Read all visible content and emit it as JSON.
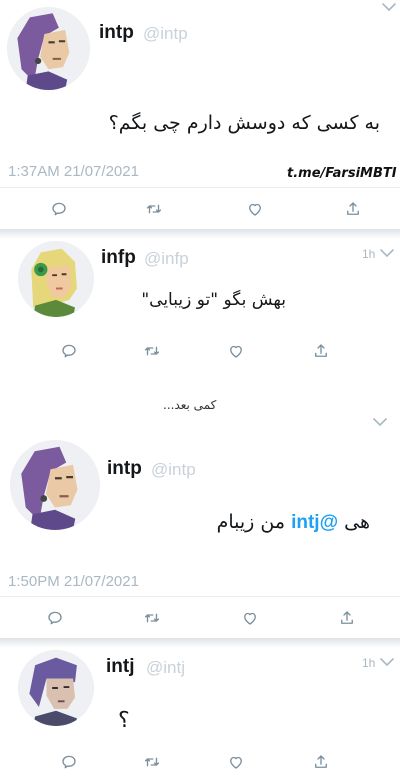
{
  "tweets": [
    {
      "name": "intp",
      "handle": "@intp",
      "text": "به کسی که دوسش دارم چی بگم؟",
      "timestamp": "1:37AM 21/07/2021"
    },
    {
      "name": "infp",
      "handle": "@infp",
      "age": "1h",
      "text": "بهش بگو \"تو زیبایی\""
    },
    {
      "name": "intp",
      "handle": "@intp",
      "text_prefix": "هی",
      "mention": "@intj",
      "text_suffix": "من زیبام",
      "timestamp": "1:50PM 21/07/2021"
    },
    {
      "name": "intj",
      "handle": "@intj",
      "age": "1h",
      "text": "؟"
    }
  ],
  "watermark": "t.me/FarsiMBTI",
  "separator_text": "کمی بعد...",
  "colors": {
    "mention": "#1da1f2",
    "muted": "#aab8c2",
    "icon": "#7b8f9e"
  },
  "icons": [
    "reply-icon",
    "retweet-icon",
    "like-icon",
    "share-icon",
    "chevron-down-icon"
  ]
}
